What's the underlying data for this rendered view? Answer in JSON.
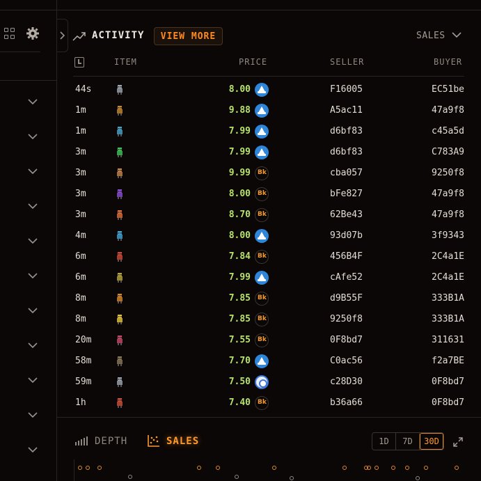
{
  "header": {
    "title": "ACTIVITY",
    "view_more_label": "VIEW MORE",
    "filter_value": "SALES"
  },
  "table": {
    "columns": [
      "ITEM",
      "PRICE",
      "SELLER",
      "BUYER"
    ],
    "rows": [
      {
        "time": "44s",
        "price": "8.00",
        "currency": "eth",
        "seller": "F16005",
        "buyer": "EC51be",
        "item_color": "#9ea7b0"
      },
      {
        "time": "1m",
        "price": "9.88",
        "currency": "eth",
        "seller": "A5ac11",
        "buyer": "47a9f8",
        "item_color": "#c8892f"
      },
      {
        "time": "1m",
        "price": "7.99",
        "currency": "eth",
        "seller": "d6bf83",
        "buyer": "c45a5d",
        "item_color": "#49a6c9"
      },
      {
        "time": "3m",
        "price": "7.99",
        "currency": "eth",
        "seller": "d6bf83",
        "buyer": "C783A9",
        "item_color": "#3fc85a"
      },
      {
        "time": "3m",
        "price": "9.99",
        "currency": "bk",
        "seller": "cba057",
        "buyer": "9250f8",
        "item_color": "#c7864a"
      },
      {
        "time": "3m",
        "price": "8.00",
        "currency": "bk",
        "seller": "bFe827",
        "buyer": "47a9f8",
        "item_color": "#8a4fd6"
      },
      {
        "time": "3m",
        "price": "8.70",
        "currency": "bk",
        "seller": "62Be43",
        "buyer": "47a9f8",
        "item_color": "#e0703a"
      },
      {
        "time": "4m",
        "price": "8.00",
        "currency": "eth",
        "seller": "93d07b",
        "buyer": "3f9343",
        "item_color": "#3fa8d8"
      },
      {
        "time": "6m",
        "price": "7.84",
        "currency": "bk",
        "seller": "456B4F",
        "buyer": "2C4a1E",
        "item_color": "#d04a3a"
      },
      {
        "time": "6m",
        "price": "7.99",
        "currency": "eth",
        "seller": "cAfe52",
        "buyer": "2C4a1E",
        "item_color": "#b8a83a"
      },
      {
        "time": "8m",
        "price": "7.85",
        "currency": "bk",
        "seller": "d9B55F",
        "buyer": "333B1A",
        "item_color": "#d88a2a"
      },
      {
        "time": "8m",
        "price": "7.85",
        "currency": "bk",
        "seller": "9250f8",
        "buyer": "333B1A",
        "item_color": "#e8c83a"
      },
      {
        "time": "20m",
        "price": "7.55",
        "currency": "bk",
        "seller": "0F8bd7",
        "buyer": "311631",
        "item_color": "#c84a6a"
      },
      {
        "time": "58m",
        "price": "7.70",
        "currency": "eth",
        "seller": "C0ac56",
        "buyer": "f2a7BE",
        "item_color": "#8a7a5a"
      },
      {
        "time": "59m",
        "price": "7.50",
        "currency": "ring",
        "seller": "c28D30",
        "buyer": "0F8bd7",
        "item_color": "#9ea7b0"
      },
      {
        "time": "1h",
        "price": "7.40",
        "currency": "bk",
        "seller": "b36a66",
        "buyer": "0F8bd7",
        "item_color": "#d0503a"
      }
    ]
  },
  "bottom": {
    "depth_label": "DEPTH",
    "sales_label": "SALES",
    "ranges": [
      "1D",
      "7D",
      "30D"
    ],
    "active_range": "30D"
  },
  "colors": {
    "accent": "#ff8a1f",
    "price": "#b7e36a",
    "eth": "#2f86d9"
  }
}
